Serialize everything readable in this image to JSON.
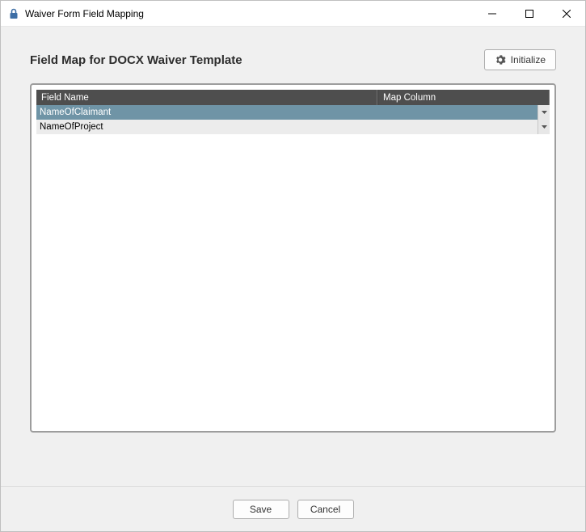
{
  "window": {
    "title": "Waiver Form Field Mapping"
  },
  "heading": "Field Map for DOCX Waiver Template",
  "initialize_label": "Initialize",
  "table": {
    "headers": {
      "field_name": "Field Name",
      "map_column": "Map Column"
    },
    "rows": [
      {
        "field_name": "NameOfClaimant",
        "map_column": "",
        "selected": true
      },
      {
        "field_name": "NameOfProject",
        "map_column": "",
        "selected": false
      }
    ]
  },
  "footer": {
    "save": "Save",
    "cancel": "Cancel"
  }
}
